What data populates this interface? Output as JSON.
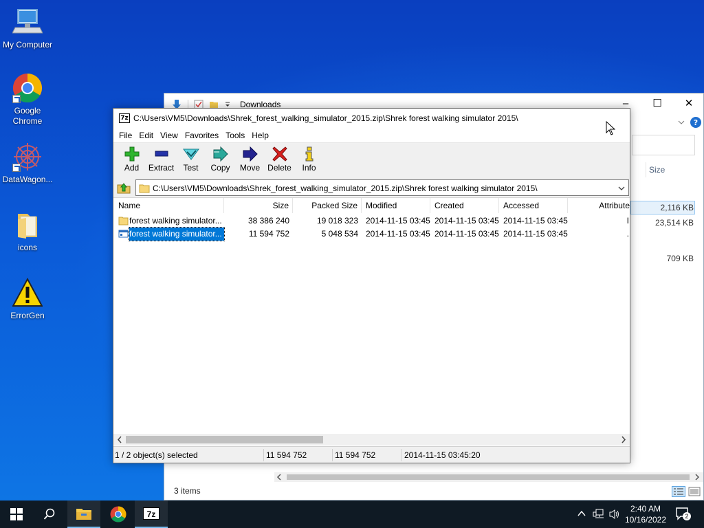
{
  "desktop": {
    "icons": [
      {
        "label": "My Computer"
      },
      {
        "label": "Google Chrome"
      },
      {
        "label": "DataWagon..."
      },
      {
        "label": "icons"
      },
      {
        "label": "ErrorGen"
      }
    ]
  },
  "explorer": {
    "title": "Downloads",
    "size_header": "Size",
    "rows": [
      "2,116 KB",
      "23,514 KB",
      "709 KB"
    ],
    "status": "3 items",
    "controls": {
      "minimize": "–",
      "maximize": "☐",
      "close": "✕"
    }
  },
  "zip": {
    "title": "C:\\Users\\VM5\\Downloads\\Shrek_forest_walking_simulator_2015.zip\\Shrek forest walking simulator 2015\\",
    "menu": [
      "File",
      "Edit",
      "View",
      "Favorites",
      "Tools",
      "Help"
    ],
    "toolbar": [
      "Add",
      "Extract",
      "Test",
      "Copy",
      "Move",
      "Delete",
      "Info"
    ],
    "address": "C:\\Users\\VM5\\Downloads\\Shrek_forest_walking_simulator_2015.zip\\Shrek forest walking simulator 2015\\",
    "columns": [
      "Name",
      "Size",
      "Packed Size",
      "Modified",
      "Created",
      "Accessed",
      "Attribute"
    ],
    "rows": [
      {
        "name": "forest walking simulator...",
        "size": "38 386 240",
        "packed": "19 018 323",
        "modified": "2014-11-15 03:45",
        "created": "2014-11-15 03:45",
        "accessed": "2014-11-15 03:45",
        "attr": "I"
      },
      {
        "name": "forest walking simulator...",
        "size": "11 594 752",
        "packed": "5 048 534",
        "modified": "2014-11-15 03:45",
        "created": "2014-11-15 03:45",
        "accessed": "2014-11-15 03:45",
        "attr": "."
      }
    ],
    "status": {
      "selected": "1 / 2 object(s) selected",
      "size": "11 594 752",
      "packed": "11 594 752",
      "date": "2014-11-15 03:45:20"
    }
  },
  "taskbar": {
    "apps": [
      "windows-start",
      "search",
      "file-explorer",
      "chrome",
      "7zip"
    ],
    "sevenzip_label": "7z",
    "time": "2:40 AM",
    "date": "10/16/2022",
    "notification_count": "2"
  },
  "colors": {
    "selection": "#0078d7",
    "add_green": "#2fb52f",
    "delete_red": "#d9201e",
    "taskbar": "#0f1a24"
  }
}
